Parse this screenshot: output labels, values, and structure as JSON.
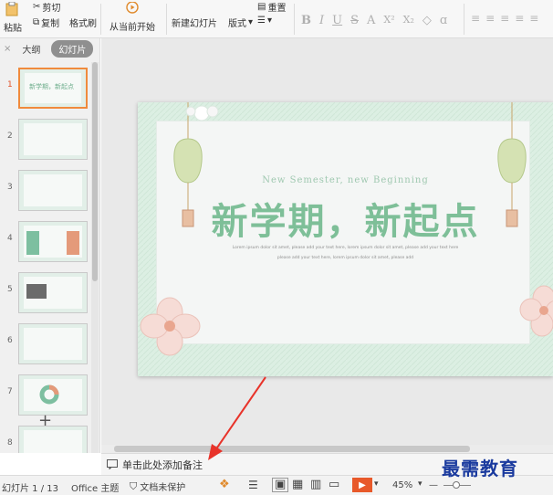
{
  "ribbon": {
    "paste_label": "粘贴",
    "cut_label": "剪切",
    "copy_label": "复制",
    "format_painter_label": "格式刷",
    "from_current_label": "从当前开始",
    "new_slide_label": "新建幻灯片",
    "layout_label": "版式",
    "reset_label": "重置",
    "format_glyphs": [
      "B",
      "I",
      "U",
      "S",
      "A",
      "X²",
      "X₂",
      "ɑ"
    ]
  },
  "left_panel": {
    "tab_outline": "大纲",
    "tab_slides": "幻灯片",
    "slide_numbers": [
      "1",
      "2",
      "3",
      "4",
      "5",
      "6",
      "7",
      "8"
    ],
    "first_thumb_title": "新学期，新起点",
    "add_label": "+"
  },
  "slide": {
    "subtitle": "New Semester, new Beginning",
    "title": "新学期，新起点",
    "body_line1": "Lorem ipsum dolor sit amet, please add your text here, lorem ipsum dolor sit amet, please add your text here",
    "body_line2": "please add your text here, lorem ipsum dolor sit amet, please add"
  },
  "notes": {
    "placeholder": "单击此处添加备注"
  },
  "status": {
    "slide_info": "幻灯片 1 / 13",
    "theme": "Office 主题",
    "protect": "文档未保护",
    "zoom": "45%"
  },
  "watermark": "最需教育",
  "colors": {
    "accent_orange": "#f08a3c",
    "slide_green": "#7ebf98",
    "arrow_red": "#e8332a",
    "watermark_blue": "#1a3a9e"
  }
}
